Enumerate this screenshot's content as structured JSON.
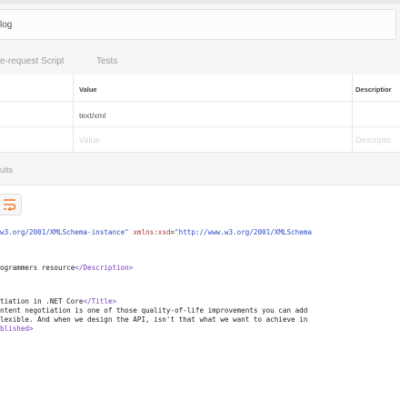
{
  "request": {
    "url_text": "log"
  },
  "subtabs": [
    "e-request Script",
    "Tests"
  ],
  "params_table": {
    "headers": {
      "value": "Value",
      "description": "Descriptior"
    },
    "rows": [
      {
        "value": "text/xml"
      }
    ],
    "placeholders": {
      "value": "Value",
      "description": "Descriptic"
    }
  },
  "results": {
    "label": "ults"
  },
  "response": {
    "line1": {
      "part1": "w3.org/2001/XMLSchema-instance\"",
      "part2": " ",
      "part3": "xmlns:xsd",
      "part4": "=",
      "part5": "\"http://www.w3.org/2001/XMLSchema"
    },
    "line2": {
      "text": "ogrammers resource",
      "tag": "</Description>"
    },
    "line3": {
      "text": "tiation in .NET Core",
      "tag": "</Title>"
    },
    "line4": "ntent negotiation is one of those quality-of-life improvements you can add",
    "line5": "lexible. And when we design the API, isn't that what we want to achieve in",
    "line6": "blished>"
  }
}
